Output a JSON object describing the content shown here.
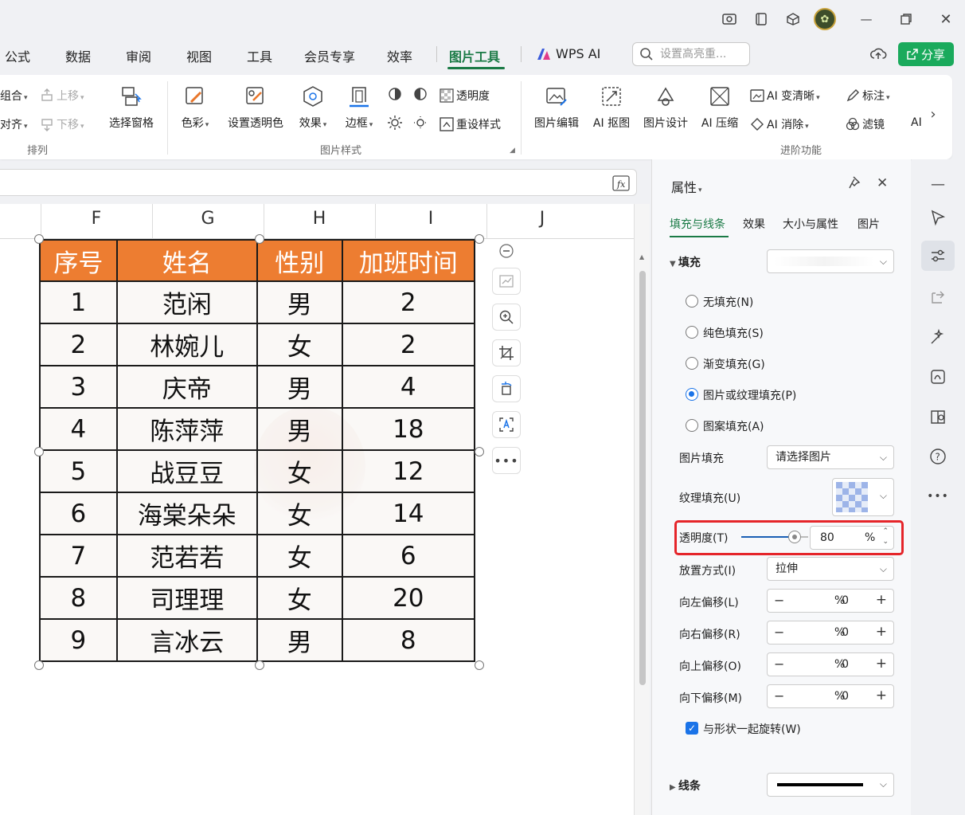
{
  "tabs": {
    "items": [
      "公式",
      "数据",
      "审阅",
      "视图",
      "工具",
      "会员专享",
      "效率",
      "图片工具",
      "WPS AI"
    ],
    "active": "图片工具",
    "search_placeholder": "设置高亮重...",
    "share_label": "分享"
  },
  "ribbon": {
    "arrange": {
      "combine": "组合",
      "align": "对齐",
      "up": "上移",
      "down": "下移",
      "selection_pane": "选择窗格",
      "group_label": "排列"
    },
    "picture_style": {
      "color": "色彩",
      "set_transparent": "设置透明色",
      "effect": "效果",
      "border": "边框",
      "transparency": "透明度",
      "reset_style": "重设样式",
      "group_label": "图片样式"
    },
    "advanced": {
      "picture_edit": "图片编辑",
      "ai_cutout": "AI 抠图",
      "picture_design": "图片设计",
      "ai_compress": "AI 压缩",
      "ai_clarity": "AI 变清晰",
      "ai_erase": "AI 消除",
      "annotate": "标注",
      "filter": "滤镜",
      "more": "AI",
      "group_label": "进阶功能"
    }
  },
  "sheet": {
    "columns": [
      "F",
      "G",
      "H",
      "I",
      "J"
    ],
    "table": {
      "headers": [
        "序号",
        "姓名",
        "性别",
        "加班时间"
      ],
      "rows": [
        [
          "1",
          "范闲",
          "男",
          "2"
        ],
        [
          "2",
          "林婉儿",
          "女",
          "2"
        ],
        [
          "3",
          "庆帝",
          "男",
          "4"
        ],
        [
          "4",
          "陈萍萍",
          "男",
          "18"
        ],
        [
          "5",
          "战豆豆",
          "女",
          "12"
        ],
        [
          "6",
          "海棠朵朵",
          "女",
          "14"
        ],
        [
          "7",
          "范若若",
          "女",
          "6"
        ],
        [
          "8",
          "司理理",
          "女",
          "20"
        ],
        [
          "9",
          "言冰云",
          "男",
          "8"
        ]
      ]
    }
  },
  "panel": {
    "title": "属性",
    "tabs": [
      "填充与线条",
      "效果",
      "大小与属性",
      "图片"
    ],
    "fill_section": "填充",
    "fill_options": [
      "无填充(N)",
      "纯色填充(S)",
      "渐变填充(G)",
      "图片或纹理填充(P)",
      "图案填充(A)"
    ],
    "selected_fill": "图片或纹理填充(P)",
    "picture_fill_label": "图片填充",
    "picture_fill_value": "请选择图片",
    "texture_fill_label": "纹理填充(U)",
    "transparency_label": "透明度(T)",
    "transparency_value": "80",
    "transparency_unit": "%",
    "transparency_level": 0.8,
    "placement_label": "放置方式(I)",
    "placement_value": "拉伸",
    "offsets": [
      {
        "label": "向左偏移(L)",
        "value": "0",
        "unit": "%"
      },
      {
        "label": "向右偏移(R)",
        "value": "0",
        "unit": "%"
      },
      {
        "label": "向上偏移(O)",
        "value": "0",
        "unit": "%"
      },
      {
        "label": "向下偏移(M)",
        "value": "0",
        "unit": "%"
      }
    ],
    "rotate_with_shape": "与形状一起旋转(W)",
    "rotate_checked": true,
    "line_section": "线条"
  },
  "colors": {
    "accent": "#1a7a45",
    "header_fill": "#ed7d31",
    "share": "#1aaa5c",
    "highlight": "#e5252a"
  }
}
